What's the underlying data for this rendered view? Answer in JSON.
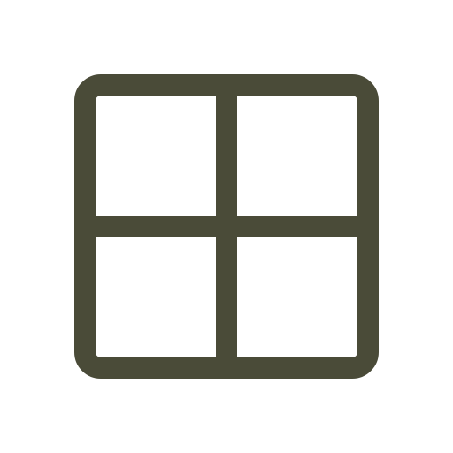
{
  "icon": {
    "name": "grid-icon",
    "stroke_color": "#4a4b38",
    "background_color": "#ffffff"
  }
}
